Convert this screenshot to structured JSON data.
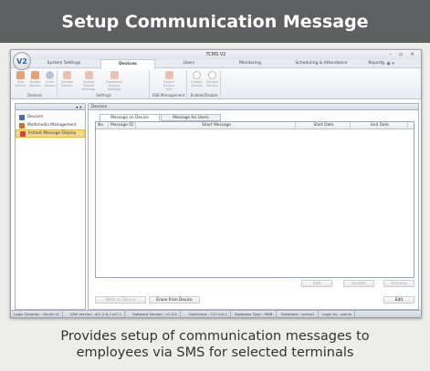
{
  "banner": {
    "title": "Setup Communication Message"
  },
  "window": {
    "title": "TCMS V2",
    "controls": "– ▫ ×",
    "logo": "V2"
  },
  "menu": {
    "tabs": [
      "System Settings",
      "Devices",
      "Users",
      "Monitoring",
      "Scheduling & Attendance",
      "Reports"
    ],
    "active": "Devices",
    "right_icons": "◇ ◉ ▾"
  },
  "ribbon": {
    "groups": [
      {
        "title": "Devices",
        "buttons": [
          "Add Device",
          "Delete Device",
          "Scan Device"
        ]
      },
      {
        "title": "Settings",
        "buttons": [
          "Disable Device",
          "Upload Device Settings",
          "Download Device Settings"
        ]
      },
      {
        "title": "USB Management",
        "buttons": [
          "Export Device Info"
        ]
      },
      {
        "title": "Enable/Disable",
        "buttons": [
          "Enable Device",
          "Disable Device"
        ]
      }
    ]
  },
  "sidebar": {
    "pin": "▾ ✕",
    "items": [
      {
        "label": "Devices",
        "color": "#4a6ea8"
      },
      {
        "label": "Multimedia Management",
        "color": "#d9692f"
      },
      {
        "label": "Instant Message Display",
        "color": "#c9483a"
      }
    ],
    "selected_index": 2
  },
  "main": {
    "header": "Devices",
    "tabs": [
      "Message on Device",
      "Message for Users"
    ],
    "columns": [
      "No.",
      "Message ID",
      "Short Message",
      "Start Date",
      "End Date"
    ],
    "buttons_right": [
      "Add",
      "Update",
      "Remove"
    ],
    "buttons_bottom": [
      "Write to Device",
      "Erase from Device"
    ],
    "edit_button": "Edit"
  },
  "status": {
    "login_duration": "Login Duration : 00:09:12",
    "sdk_version": "SDK Version : 6.2.2.6-1147-1",
    "software_version": "Software Version : v1.0.0",
    "hostname": "Hostname : 127.0.0.1",
    "database_type": "Database Type : MDB",
    "database": "Database : tcmsv2",
    "login_as": "Login As : admin"
  },
  "caption": {
    "line1": "Provides setup of communication messages to",
    "line2": "employees via SMS for selected terminals"
  },
  "colors": {
    "banner": "#5d5f60",
    "selected": "#f7d98c",
    "accent": "#2a60a8"
  }
}
